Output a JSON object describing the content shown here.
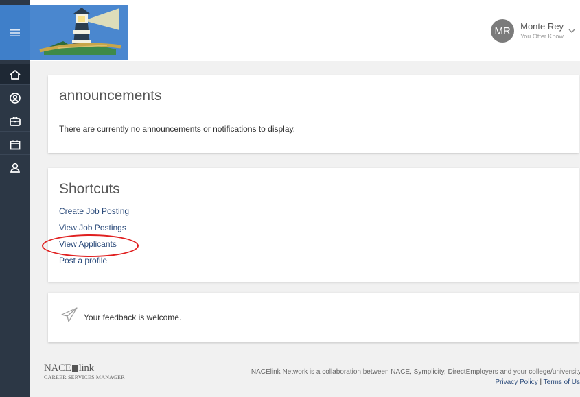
{
  "header": {
    "user": {
      "initials": "MR",
      "name": "Monte Rey",
      "subtitle": "You Otter Know"
    }
  },
  "announcements": {
    "title": "announcements",
    "message": "There are currently no announcements or notifications to display."
  },
  "shortcuts": {
    "title": "Shortcuts",
    "items": [
      {
        "label": "Create Job Posting"
      },
      {
        "label": "View Job Postings"
      },
      {
        "label": "View Applicants"
      },
      {
        "label": "Post a profile"
      }
    ]
  },
  "feedback": {
    "text": "Your feedback is welcome."
  },
  "footer": {
    "logo_main": "NACE",
    "logo_link": "link",
    "logo_sub": "CAREER SERVICES MANAGER",
    "text": "NACElink Network is a collaboration between NACE, Symplicity, DirectEmployers and your college/university",
    "privacy": "Privacy Policy",
    "separator": " | ",
    "terms": "Terms of Us"
  },
  "colors": {
    "rail": "#2c3745",
    "accent": "#3f7fc9",
    "highlight": "#e02020"
  },
  "icons": {
    "menu": "hamburger-icon",
    "home": "home-icon",
    "profile": "profile-icon",
    "jobs": "briefcase-icon",
    "calendar": "calendar-icon",
    "network": "person-icon",
    "feedback": "paper-plane-icon",
    "user_menu": "chevron-down-icon"
  }
}
